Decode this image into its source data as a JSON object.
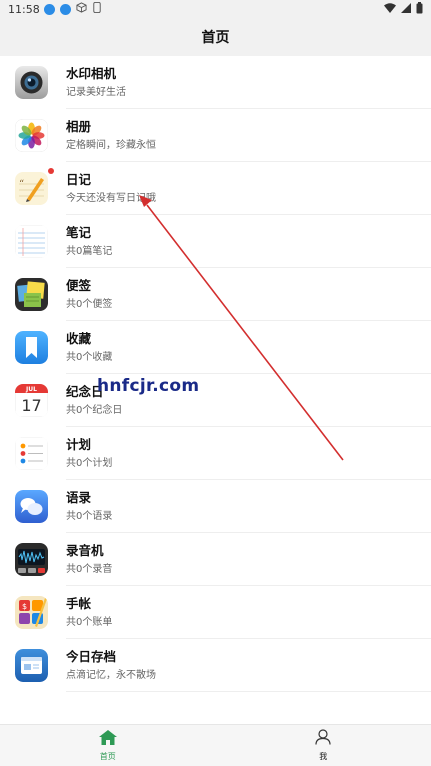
{
  "status_bar": {
    "time": "11:58"
  },
  "header": {
    "title": "首页"
  },
  "items": [
    {
      "title": "水印相机",
      "subtitle": "记录美好生活",
      "icon": "camera-icon"
    },
    {
      "title": "相册",
      "subtitle": "定格瞬间，珍藏永恒",
      "icon": "photos-icon"
    },
    {
      "title": "日记",
      "subtitle": "今天还没有写日记哦",
      "icon": "diary-icon",
      "badge": true
    },
    {
      "title": "笔记",
      "subtitle": "共0篇笔记",
      "icon": "notes-icon"
    },
    {
      "title": "便签",
      "subtitle": "共0个便签",
      "icon": "sticky-notes-icon"
    },
    {
      "title": "收藏",
      "subtitle": "共0个收藏",
      "icon": "bookmark-icon"
    },
    {
      "title": "纪念日",
      "subtitle": "共0个纪念日",
      "icon": "calendar-icon"
    },
    {
      "title": "计划",
      "subtitle": "共0个计划",
      "icon": "reminders-icon"
    },
    {
      "title": "语录",
      "subtitle": "共0个语录",
      "icon": "quotes-icon"
    },
    {
      "title": "录音机",
      "subtitle": "共0个录音",
      "icon": "voice-recorder-icon"
    },
    {
      "title": "手帐",
      "subtitle": "共0个账单",
      "icon": "ledger-icon"
    },
    {
      "title": "今日存档",
      "subtitle": "点滴记忆，永不散场",
      "icon": "archive-icon"
    }
  ],
  "calendar_icon": {
    "month": "JUL",
    "day": "17"
  },
  "watermark": "hnfcjr.com",
  "tabs": [
    {
      "label": "首页",
      "icon": "home-icon",
      "active": true,
      "color": "#2e9a55"
    },
    {
      "label": "我",
      "icon": "person-icon",
      "active": false
    }
  ],
  "annotation": {
    "color": "#d32f2f"
  }
}
